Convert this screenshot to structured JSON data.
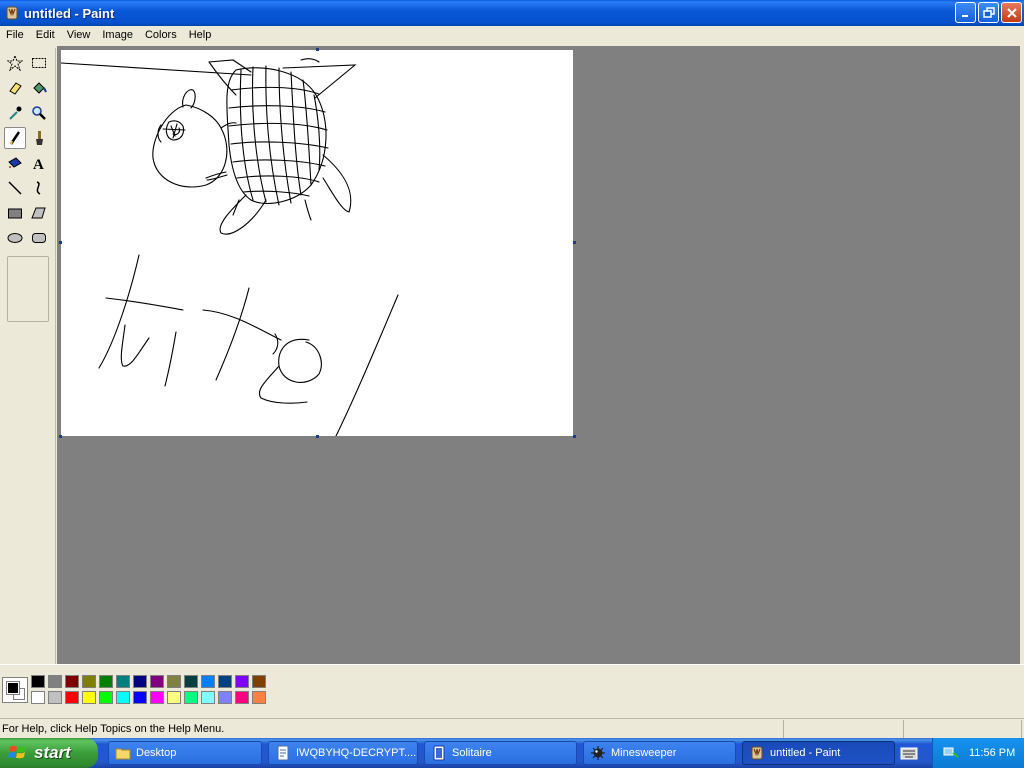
{
  "window": {
    "title": "untitled - Paint"
  },
  "menu": [
    "File",
    "Edit",
    "View",
    "Image",
    "Colors",
    "Help"
  ],
  "toolbox": {
    "tools": [
      "free-form-select",
      "select",
      "eraser",
      "fill-with-color",
      "pick-color",
      "magnifier",
      "pencil",
      "brush",
      "airbrush",
      "text",
      "line",
      "curve",
      "rectangle",
      "polygon",
      "ellipse",
      "rounded-rectangle"
    ],
    "active_tool": "pencil"
  },
  "palette": {
    "foreground": "#000000",
    "background": "#ffffff",
    "colors_row1": [
      "#000000",
      "#808080",
      "#800000",
      "#808000",
      "#008000",
      "#008080",
      "#000080",
      "#800080",
      "#808040",
      "#004040",
      "#0080ff",
      "#004080",
      "#8000ff",
      "#804000"
    ],
    "colors_row2": [
      "#ffffff",
      "#c0c0c0",
      "#ff0000",
      "#ffff00",
      "#00ff00",
      "#00ffff",
      "#0000ff",
      "#ff00ff",
      "#ffff80",
      "#00ff80",
      "#80ffff",
      "#8080ff",
      "#ff0080",
      "#ff8040"
    ]
  },
  "status": {
    "help_text": "For Help, click Help Topics on the Help Menu."
  },
  "taskbar": {
    "start_label": "start",
    "buttons": [
      {
        "label": "Desktop",
        "icon": "folder-icon"
      },
      {
        "label": "IWQBYHQ-DECRYPT....",
        "icon": "notepad-icon"
      },
      {
        "label": "Solitaire",
        "icon": "solitaire-icon"
      },
      {
        "label": "Minesweeper",
        "icon": "minesweeper-icon"
      },
      {
        "label": "untitled - Paint",
        "icon": "paint-icon"
      }
    ],
    "clock": "11:56 PM"
  }
}
